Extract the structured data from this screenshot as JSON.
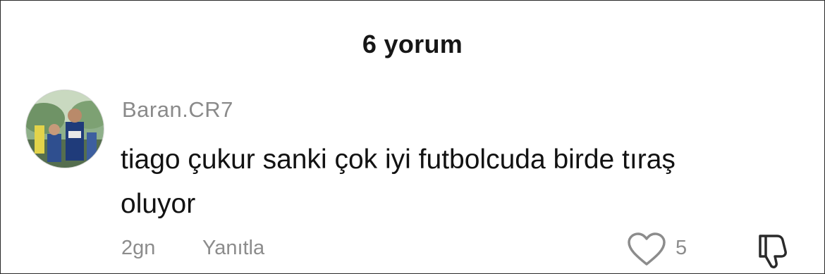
{
  "comments_header": {
    "title": "6 yorum"
  },
  "comment": {
    "avatar_icon": "user-avatar-photo",
    "username": "Baran.CR7",
    "text": "tiago çukur sanki çok iyi futbolcuda birde tıraş oluyor",
    "time": "2gn",
    "reply_label": "Yanıtla",
    "like_icon": "heart-outline-icon",
    "like_count": "5",
    "dislike_icon": "thumbs-down-icon"
  },
  "colors": {
    "title": "#161616",
    "text": "#121212",
    "muted": "#8c8c8c",
    "border": "#2a2a2a"
  }
}
